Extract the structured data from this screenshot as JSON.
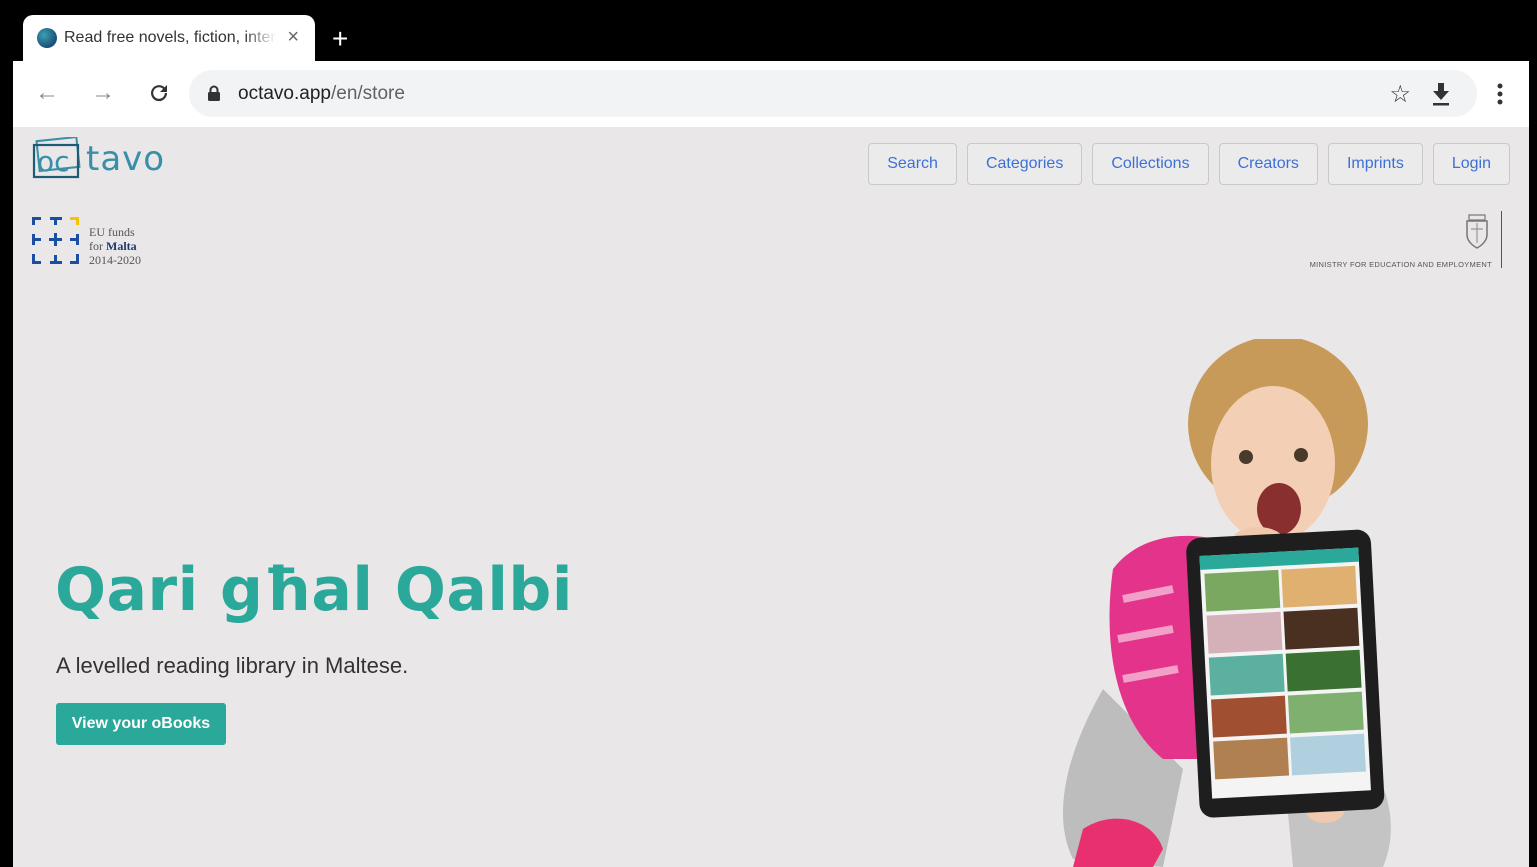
{
  "browser": {
    "tab_title": "Read free novels, fiction, interactive books",
    "tab_close": "×",
    "new_tab": "+",
    "back": "←",
    "forward": "→",
    "reload": "C",
    "url_host": "octavo.app",
    "url_path": "/en/store",
    "bookmark": "☆"
  },
  "site": {
    "logo_text": "tavo",
    "logo_mark": "oc",
    "nav": [
      "Search",
      "Categories",
      "Collections",
      "Creators",
      "Imprints",
      "Login"
    ],
    "eu_line1": "EU funds",
    "eu_line2_prefix": "for ",
    "eu_line2_bold": "Malta",
    "eu_line3": "2014-2020",
    "ministry": "MINISTRY FOR EDUCATION AND EMPLOYMENT"
  },
  "hero": {
    "title": "Qari għal Qalbi",
    "subtitle": "A levelled reading library in Maltese.",
    "cta": "View your oBooks"
  },
  "colors": {
    "accent": "#2aa89a",
    "link": "#3d6fd9",
    "logo": "#3a8fa8",
    "page_bg": "#e9e7e8"
  }
}
